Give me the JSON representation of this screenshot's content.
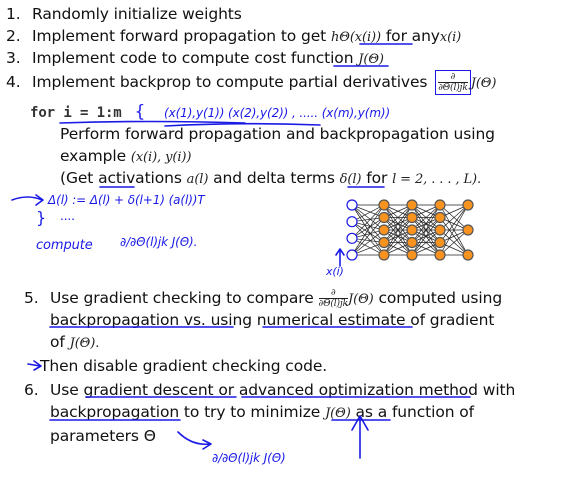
{
  "steps": [
    {
      "num": "1.",
      "text": "Randomly initialize weights"
    },
    {
      "num": "2.",
      "text": "Implement forward propagation to get",
      "math": "hΘ(x(i))",
      "tail": "for any",
      "tail_math": "x(i)"
    },
    {
      "num": "3.",
      "text": "Implement code to compute cost function",
      "math": "J(Θ)"
    },
    {
      "num": "4.",
      "text": "Implement backprop to compute partial derivatives",
      "frac_top": "∂",
      "frac_bot": "∂Θ(l)jk",
      "math": "J(Θ)"
    }
  ],
  "loop": {
    "code": "for i = 1:m",
    "brace": "{",
    "hw_examples": "(x(1),y(1))   (x(2),y(2)) , ..... (x(m),y(m))"
  },
  "body": {
    "line1": "Perform forward propagation and backpropagation using",
    "line2": "example",
    "line2_math": "(x(i), y(i))",
    "line3_a": "(Get activations",
    "line3_m1": "a(l)",
    "line3_b": "and delta terms",
    "line3_m2": "δ(l)",
    "line3_c": "for",
    "line3_m3": "l = 2, . . . , L)."
  },
  "handwriting": {
    "delta_update": "Δ(l) := Δ(l) + δ(l+1) (a(l))T",
    "dots": "....",
    "close_brace": "}",
    "compute": "compute",
    "partial": "∂/∂Θ(l)jk J(Θ).",
    "x_label": "x(i)"
  },
  "steps2": {
    "s5_num": "5.",
    "s5_a": "Use gradient checking to compare",
    "s5_frac_top": "∂",
    "s5_frac_bot": "∂Θ(l)jk",
    "s5_math": "J(Θ)",
    "s5_b": "computed using",
    "s5_c": "backpropagation vs. using",
    "s5_d": "numerical estimate",
    "s5_e": "of gradient",
    "s5_f": "of",
    "s5_f_math": "J(Θ).",
    "then": "Then disable gradient checking code.",
    "s6_num": "6.",
    "s6_a": "Use",
    "s6_b": "gradient descent",
    "s6_c": "or",
    "s6_d": "advanced optimization method",
    "s6_e": "with",
    "s6_f": "backpropagation",
    "s6_g": "to try to  minimize",
    "s6_math": "J(Θ)",
    "s6_h": "as a function of",
    "s6_i": "parameters Θ",
    "hw_bottom": "∂/∂Θ(l)jk J(Θ)"
  },
  "colors": {
    "ink": "#1a1ae6",
    "node_fill": "#f7931e",
    "node_stroke": "#555555",
    "text": "#111111"
  }
}
